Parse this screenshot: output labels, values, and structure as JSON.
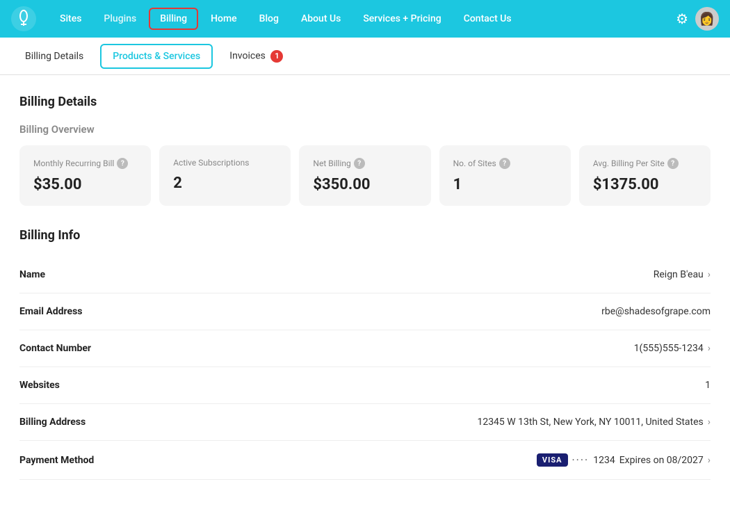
{
  "nav": {
    "links": [
      {
        "id": "sites",
        "label": "Sites",
        "active": false
      },
      {
        "id": "plugins",
        "label": "Plugins",
        "active": false,
        "muted": true
      },
      {
        "id": "billing",
        "label": "Billing",
        "active": true
      },
      {
        "id": "home",
        "label": "Home",
        "active": false
      },
      {
        "id": "blog",
        "label": "Blog",
        "active": false
      },
      {
        "id": "about",
        "label": "About Us",
        "active": false
      },
      {
        "id": "services",
        "label": "Services + Pricing",
        "active": false
      },
      {
        "id": "contact",
        "label": "Contact Us",
        "active": false
      }
    ]
  },
  "subnav": {
    "items": [
      {
        "id": "billing-details",
        "label": "Billing Details",
        "active": false
      },
      {
        "id": "products-services",
        "label": "Products & Services",
        "active": true
      },
      {
        "id": "invoices",
        "label": "Invoices",
        "active": false,
        "badge": "1"
      }
    ]
  },
  "main": {
    "page_title": "Billing Details",
    "overview_title": "Billing Overview",
    "cards": [
      {
        "id": "monthly-recurring",
        "label": "Monthly Recurring Bill",
        "value": "$35.00",
        "help": true
      },
      {
        "id": "active-subscriptions",
        "label": "Active Subscriptions",
        "value": "2",
        "help": false
      },
      {
        "id": "net-billing",
        "label": "Net Billing",
        "value": "$350.00",
        "help": true
      },
      {
        "id": "no-of-sites",
        "label": "No. of Sites",
        "value": "1",
        "help": true
      },
      {
        "id": "avg-billing",
        "label": "Avg. Billing Per Site",
        "value": "$1375.00",
        "help": true
      }
    ],
    "billing_info_title": "Billing Info",
    "info_rows": [
      {
        "id": "name",
        "label": "Name",
        "value": "Reign B'eau",
        "clickable": true
      },
      {
        "id": "email",
        "label": "Email Address",
        "value": "rbe@shadesofgrape.com",
        "clickable": false
      },
      {
        "id": "contact",
        "label": "Contact Number",
        "value": "1(555)555-1234",
        "clickable": true
      },
      {
        "id": "websites",
        "label": "Websites",
        "value": "1",
        "clickable": false
      },
      {
        "id": "billing-address",
        "label": "Billing Address",
        "value": "12345 W 13th St, New York, NY 10011, United States",
        "clickable": true
      },
      {
        "id": "payment-method",
        "label": "Payment Method",
        "value": "··· 1234   Expires on  08/2027",
        "is_payment": true,
        "clickable": true
      }
    ]
  }
}
